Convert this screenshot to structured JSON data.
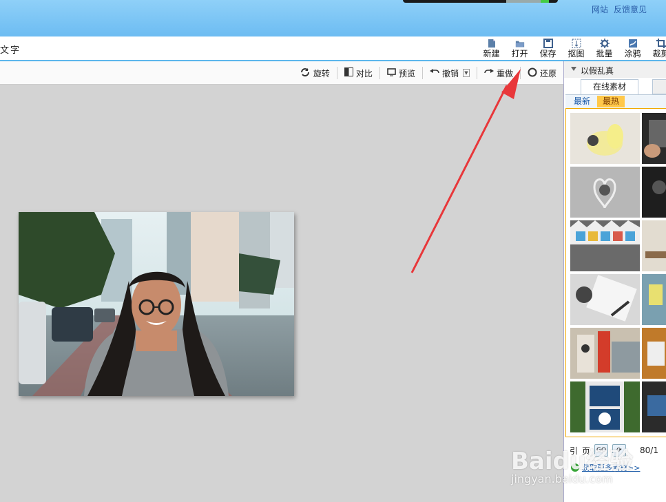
{
  "titlebar": {
    "links": [
      "网站",
      "反馈意见"
    ]
  },
  "menu": {
    "label": "文字",
    "tools": [
      {
        "label": "新建",
        "icon": "new-file-icon"
      },
      {
        "label": "打开",
        "icon": "open-folder-icon"
      },
      {
        "label": "保存",
        "icon": "save-icon"
      },
      {
        "label": "抠图",
        "icon": "cutout-icon"
      },
      {
        "label": "批量",
        "icon": "batch-gear-icon"
      },
      {
        "label": "涂鸦",
        "icon": "doodle-icon"
      },
      {
        "label": "裁剪",
        "icon": "crop-icon"
      }
    ]
  },
  "toolbar": {
    "rotate": "旋转",
    "compare": "对比",
    "preview": "预览",
    "undo": "撤销",
    "redo": "重做",
    "restore": "还原"
  },
  "panel": {
    "title": "以假乱真",
    "tab_online": "在线素材",
    "subtab_new": "最新",
    "subtab_hot": "最热",
    "pager_first": "引",
    "pager_page": "页",
    "pager_go": "GO",
    "count": "80/1",
    "more_link": "获取更多素材>>"
  },
  "watermark": {
    "brand": "Baidu经验",
    "domain": "jingyan.baidu.com"
  },
  "colors": {
    "titlebar": "#7cc6f5",
    "accent_line": "#5cb6ec",
    "canvas": "#d3d3d3",
    "hot_tab": "#ffc84a",
    "arrow": "#e8373a"
  }
}
